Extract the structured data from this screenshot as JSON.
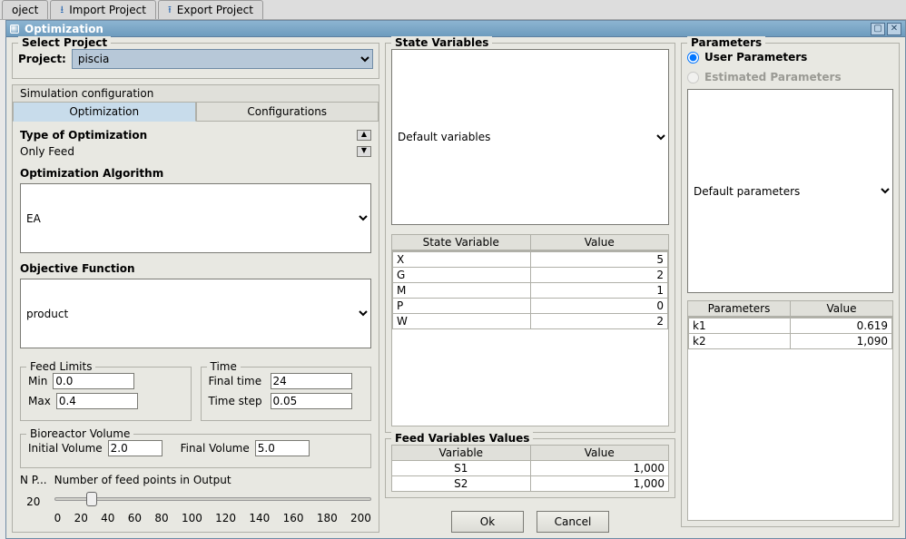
{
  "toolbar": {
    "tab0": "oject",
    "tab1": "Import Project",
    "tab2": "Export Project"
  },
  "window": {
    "title": "Optimization"
  },
  "project": {
    "box_title": "Select Project",
    "label": "Project:",
    "value": "piscia"
  },
  "simtabs": {
    "group_label": "Simulation configuration",
    "tab_opt": "Optimization",
    "tab_conf": "Configurations"
  },
  "opt": {
    "type_label": "Type of Optimization",
    "type_value": "Only Feed",
    "algo_label": "Optimization Algorithm",
    "algo_value": "EA",
    "obj_label": "Objective Function",
    "obj_value": "product"
  },
  "feed_limits": {
    "title": "Feed Limits",
    "min_label": "Min",
    "min_value": "0.0",
    "max_label": "Max",
    "max_value": "0.4"
  },
  "time": {
    "title": "Time",
    "final_label": "Final time",
    "final_value": "24",
    "step_label": "Time step",
    "step_value": "0.05"
  },
  "bioreactor": {
    "title": "Bioreactor Volume",
    "init_label": "Initial Volume",
    "init_value": "2.0",
    "final_label": "Final Volume",
    "final_value": "5.0"
  },
  "slider": {
    "short_label": "N P...",
    "long_label": "Number of feed points in Output",
    "value": "20",
    "ticks": [
      "0",
      "20",
      "40",
      "60",
      "80",
      "100",
      "120",
      "140",
      "160",
      "180",
      "200"
    ]
  },
  "state_vars": {
    "title": "State Variables",
    "select": "Default variables",
    "col1": "State Variable",
    "col2": "Value",
    "rows": [
      {
        "name": "X",
        "value": "5"
      },
      {
        "name": "G",
        "value": "2"
      },
      {
        "name": "M",
        "value": "1"
      },
      {
        "name": "P",
        "value": "0"
      },
      {
        "name": "W",
        "value": "2"
      }
    ]
  },
  "feed_vals": {
    "title": "Feed Variables Values",
    "col1": "Variable",
    "col2": "Value",
    "rows": [
      {
        "name": "S1",
        "value": "1,000"
      },
      {
        "name": "S2",
        "value": "1,000"
      }
    ]
  },
  "params": {
    "title": "Parameters",
    "radio_user": "User Parameters",
    "radio_est": "Estimated Parameters",
    "select": "Default parameters",
    "col1": "Parameters",
    "col2": "Value",
    "rows": [
      {
        "name": "k1",
        "value": "0.619"
      },
      {
        "name": "k2",
        "value": "1,090"
      }
    ]
  },
  "buttons": {
    "ok": "Ok",
    "cancel": "Cancel"
  }
}
